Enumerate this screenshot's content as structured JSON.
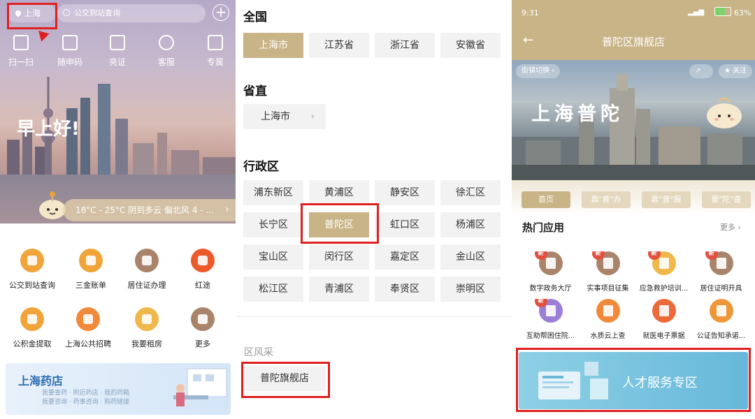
{
  "panel1": {
    "location": "上海",
    "search_placeholder": "公交到站查询",
    "quick_actions": [
      {
        "label": "扫一扫",
        "icon": "scan-icon"
      },
      {
        "label": "随申码",
        "icon": "qrcode-icon"
      },
      {
        "label": "亮证",
        "icon": "card-icon"
      },
      {
        "label": "客服",
        "icon": "headset-icon"
      },
      {
        "label": "专属",
        "icon": "crown-icon"
      }
    ],
    "greeting": "早上好!",
    "weather": "18°C - 25°C  阴到多云  偏北风 4 - ...",
    "services": [
      {
        "label": "公交到站查询",
        "color": "#f0a43a",
        "icon": "bus-icon"
      },
      {
        "label": "三金账单",
        "color": "#f0a43a",
        "icon": "bill-icon"
      },
      {
        "label": "居住证办理",
        "color": "#a9846b",
        "icon": "idcard-icon"
      },
      {
        "label": "红途",
        "color": "#ec5a2b",
        "icon": "star-icon"
      },
      {
        "label": "公积金提取",
        "color": "#f0a43a",
        "icon": "money-bag-icon"
      },
      {
        "label": "上海公共招聘",
        "color": "#f08a3a",
        "icon": "recruit-icon"
      },
      {
        "label": "我要租房",
        "color": "#f0b84a",
        "icon": "house-icon"
      },
      {
        "label": "更多",
        "color": "#a9846b",
        "icon": "grid-icon"
      }
    ],
    "banner_title": "上海药店",
    "banner_line1": "我要查药 · 附近药店 · 我的药箱",
    "banner_line2": "我要咨询 · 药事咨询 · 购药链接"
  },
  "panel2": {
    "section_national": "全国",
    "provinces": [
      "上海市",
      "江苏省",
      "浙江省",
      "安徽省"
    ],
    "section_provincial": "省直",
    "provincial_item": "上海市",
    "section_districts": "行政区",
    "districts": [
      "浦东新区",
      "黄浦区",
      "静安区",
      "徐汇区",
      "长宁区",
      "普陀区",
      "虹口区",
      "杨浦区",
      "宝山区",
      "闵行区",
      "嘉定区",
      "金山区",
      "松江区",
      "青浦区",
      "奉贤区",
      "崇明区"
    ],
    "selected_district": "普陀区",
    "section_style": "区风采",
    "flagship": "普陀旗舰店"
  },
  "panel3": {
    "time": "9:31",
    "battery": "63",
    "title": "普陀区旗舰店",
    "town_switch": "街镇切换",
    "follow": "关注",
    "hero_title": "上海普陀",
    "tabs": [
      "首页",
      "靠\"普\"办",
      "靠\"普\"服",
      "要\"陀\"查"
    ],
    "hot_apps_title": "热门应用",
    "more": "更多",
    "badge_text": "新",
    "apps": [
      {
        "label": "数字政务大厅",
        "color": "#a9846b",
        "new": true,
        "icon": "hall-icon"
      },
      {
        "label": "实事项目征集",
        "color": "#a9846b",
        "new": true,
        "icon": "project-icon"
      },
      {
        "label": "应急救护培训...",
        "color": "#f0b84a",
        "new": true,
        "icon": "firstaid-icon"
      },
      {
        "label": "居住证明开具",
        "color": "#a9846b",
        "new": true,
        "icon": "certificate-icon"
      },
      {
        "label": "互助帮困住院...",
        "color": "#9b7ed6",
        "new": true,
        "icon": "aid-icon"
      },
      {
        "label": "水质云上查",
        "color": "#f08a3a",
        "new": false,
        "icon": "water-drop-icon"
      },
      {
        "label": "就医电子票据",
        "color": "#ec6a3a",
        "new": false,
        "icon": "camera-icon"
      },
      {
        "label": "公证告知承诺...",
        "color": "#f0963a",
        "new": false,
        "icon": "notary-icon"
      }
    ],
    "banner_title": "人才服务专区"
  },
  "colors": {
    "gold": "#c8b486",
    "highlight": "#e02020"
  }
}
